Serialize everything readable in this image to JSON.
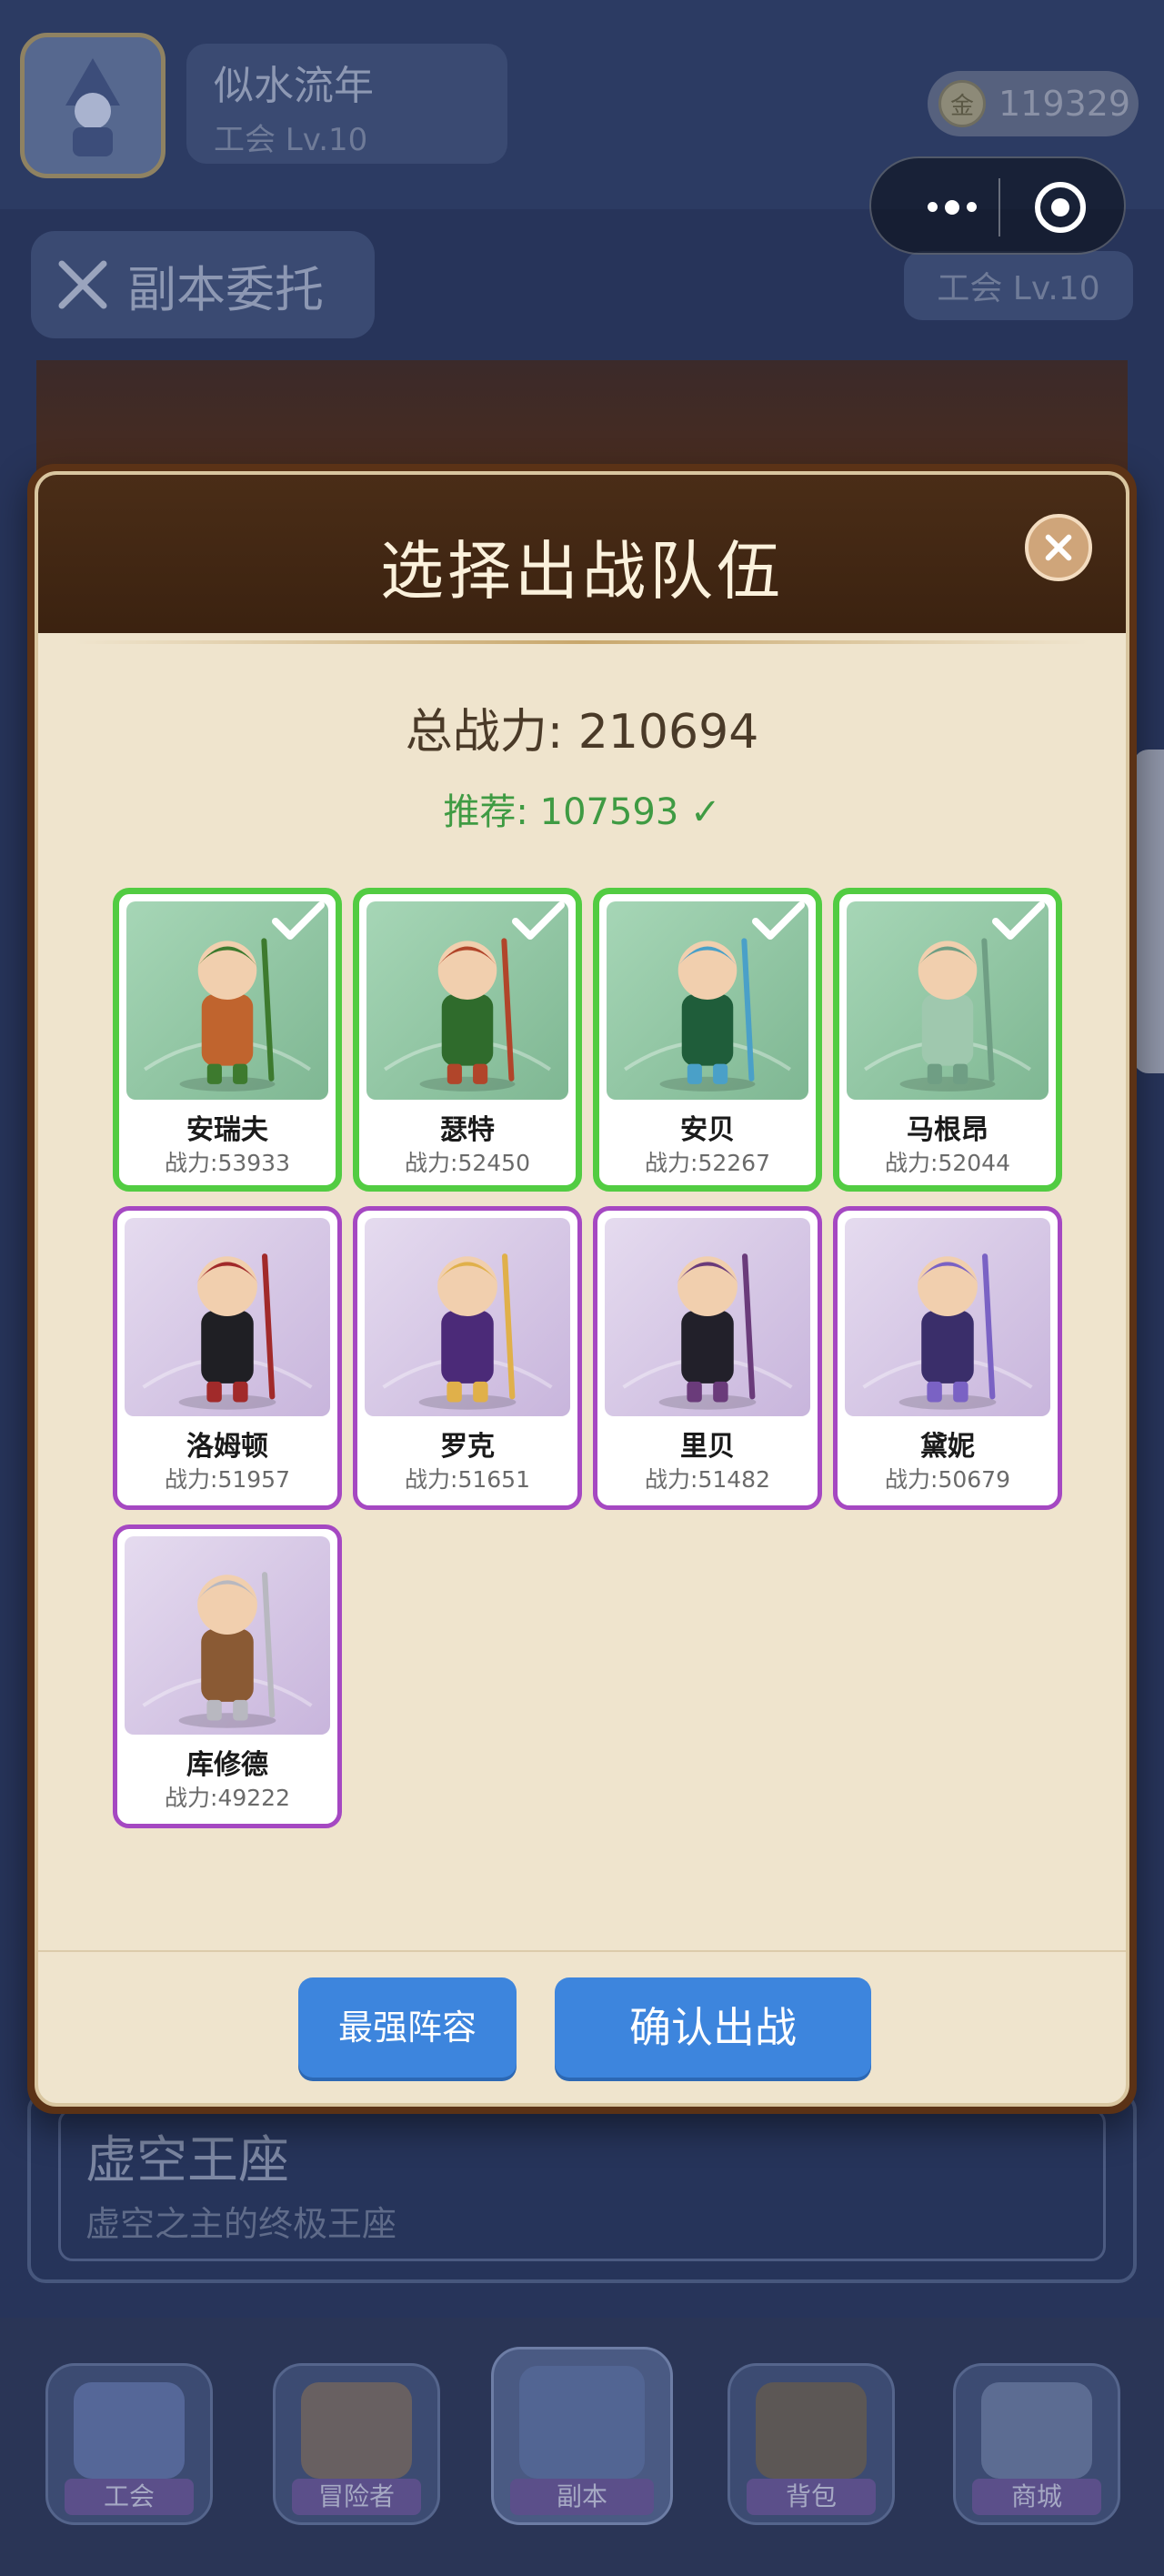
{
  "background": {
    "user": {
      "name": "似水流年",
      "level": "工会 Lv.10"
    },
    "coins": {
      "icon": "coin-icon",
      "icon_glyph": "金",
      "value": "119329"
    },
    "guild_level": "工会 Lv.10",
    "dungeon_tab": {
      "icon": "crossed-swords-icon",
      "label": "副本委托"
    },
    "dungeon_card": {
      "title": "虚空王座",
      "description": "虚空之主的终极王座"
    },
    "bottom_nav": [
      {
        "label": "工会",
        "icon": "castle-icon"
      },
      {
        "label": "冒险者",
        "icon": "adventurer-icon"
      },
      {
        "label": "副本",
        "icon": "dungeon-icon",
        "active": true
      },
      {
        "label": "背包",
        "icon": "backpack-icon"
      },
      {
        "label": "商城",
        "icon": "shop-cart-icon"
      }
    ]
  },
  "mini_program_capsule": {
    "more": "more-icon",
    "close": "target-icon"
  },
  "modal": {
    "title": "选择出战队伍",
    "total_power": "总战力: 210694",
    "recommend": "推荐: 107593 ✓",
    "heroes": [
      {
        "name": "安瑞夫",
        "power_label": "战力:",
        "power": "53933",
        "selected": true,
        "art_color": "#c0642e",
        "art_accent": "#3d7a2e"
      },
      {
        "name": "瑟特",
        "power_label": "战力:",
        "power": "52450",
        "selected": true,
        "art_color": "#2f6b2c",
        "art_accent": "#b1452a"
      },
      {
        "name": "安贝",
        "power_label": "战力:",
        "power": "52267",
        "selected": true,
        "art_color": "#1f5d3a",
        "art_accent": "#4aa0c8"
      },
      {
        "name": "马根昂",
        "power_label": "战力:",
        "power": "52044",
        "selected": true,
        "art_color": "#9fc8ae",
        "art_accent": "#6f9e84"
      },
      {
        "name": "洛姆顿",
        "power_label": "战力:",
        "power": "51957",
        "selected": false,
        "art_color": "#1f1f24",
        "art_accent": "#a12a2a"
      },
      {
        "name": "罗克",
        "power_label": "战力:",
        "power": "51651",
        "selected": false,
        "art_color": "#4b2a78",
        "art_accent": "#e0b04a"
      },
      {
        "name": "里贝",
        "power_label": "战力:",
        "power": "51482",
        "selected": false,
        "art_color": "#22202a",
        "art_accent": "#6a3b7a"
      },
      {
        "name": "黛妮",
        "power_label": "战力:",
        "power": "50679",
        "selected": false,
        "art_color": "#3a2e6a",
        "art_accent": "#7a62c4"
      },
      {
        "name": "库修德",
        "power_label": "战力:",
        "power": "49222",
        "selected": false,
        "art_color": "#8a5a34",
        "art_accent": "#b8b8c0"
      }
    ],
    "buttons": {
      "strongest": "最强阵容",
      "confirm": "确认出战"
    }
  },
  "colors": {
    "selected_border": "#52cc42",
    "unselected_border": "#a548c2",
    "button_blue": "#3d85dd",
    "recommend_green": "#3f9b43",
    "header_brown": "#3b2210"
  }
}
